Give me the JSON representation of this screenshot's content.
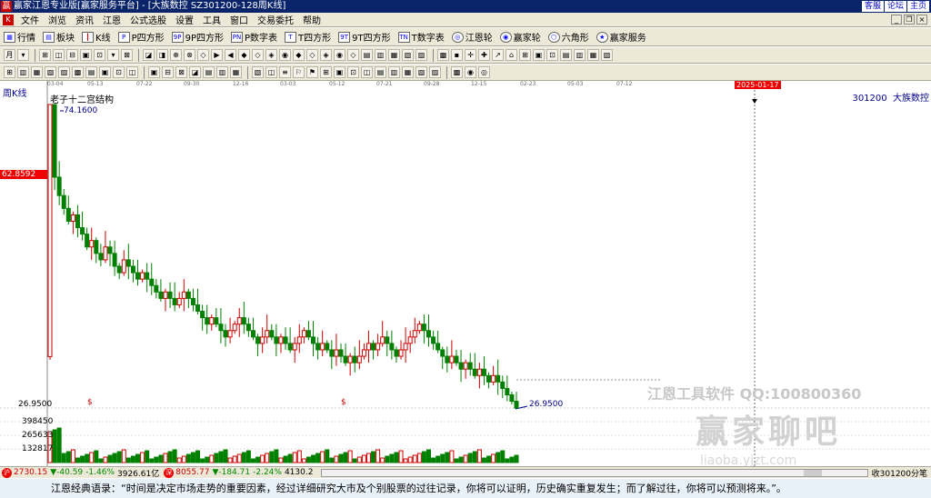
{
  "titlebar": {
    "title": "赢家江恩专业版[赢家服务平台] - [大族数控 SZ301200-128周K线]",
    "links": [
      "客服",
      "论坛",
      "主页"
    ]
  },
  "menubar": {
    "items": [
      "文件",
      "浏览",
      "资讯",
      "江恩",
      "公式选股",
      "设置",
      "工具",
      "窗口",
      "交易委托",
      "帮助"
    ]
  },
  "toolbar1": {
    "items": [
      {
        "label": "行情",
        "icon": "grid-icon"
      },
      {
        "label": "板块",
        "icon": "blocks-icon"
      },
      {
        "label": "K线",
        "icon": "candle-icon"
      },
      {
        "label": "P四方形",
        "icon": "p-square-icon"
      },
      {
        "label": "9P四方形",
        "icon": "9p-square-icon"
      },
      {
        "label": "P数字表",
        "icon": "p-number-table-icon"
      },
      {
        "label": "T四方形",
        "icon": "t-square-icon"
      },
      {
        "label": "9T四方形",
        "icon": "9t-square-icon"
      },
      {
        "label": "T数字表",
        "icon": "t-number-table-icon"
      },
      {
        "label": "江恩轮",
        "icon": "gann-wheel-icon"
      },
      {
        "label": "赢家轮",
        "icon": "winner-wheel-icon"
      },
      {
        "label": "六角形",
        "icon": "hexagon-icon"
      },
      {
        "label": "赢家服务",
        "icon": "service-icon"
      }
    ]
  },
  "chart": {
    "period_label": "周K线",
    "indicator_name": "老子十二宫结构",
    "stock_code": "301200",
    "stock_name": "大族数控",
    "dates": [
      "03-04",
      "05-13",
      "07-22",
      "09-30",
      "12-16",
      "03-03",
      "05-12",
      "07-21",
      "09-28",
      "12-15",
      "02-23",
      "05-03",
      "07-12"
    ],
    "date_marker": "2025-01-17",
    "max_price": "74.1600",
    "min_price": "26.9500",
    "current_price_tag": "62.8592",
    "axis_low": "26.9500",
    "volume_ticks": [
      "398450",
      "265633",
      "132817"
    ],
    "markers": [
      "$",
      "$"
    ]
  },
  "chart_data": {
    "type": "candlestick",
    "title": "老子十二宫结构",
    "max": 74.16,
    "min": 26.95,
    "candles_close_approx": [
      74.16,
      62.86,
      58,
      55,
      52,
      48,
      46,
      47,
      45,
      44,
      46,
      48,
      47,
      45,
      46,
      44,
      42,
      40,
      39,
      38,
      40,
      39,
      38,
      37,
      36,
      37,
      38,
      37,
      36,
      35,
      34,
      33,
      32,
      31,
      30,
      29,
      28,
      26.95
    ]
  },
  "watermark": {
    "line1": "江恩工具软件 QQ:100800360",
    "line2": "赢家聊吧",
    "line3": "liaoba.yjzt.com"
  },
  "statusbar": {
    "index1_value": "2730.15",
    "index1_change": "▼-40.59",
    "index1_pct": "-1.46%",
    "index1_amount": "3926.61亿",
    "index2_value": "8055.77",
    "index2_change": "▼-184.71",
    "index2_pct": "-2.24%",
    "index2_amount": "4130.2",
    "right_info": "收301200分笔"
  },
  "quote": {
    "text": "江恩经典语录：“时间是决定市场走势的重要因素，经过详细研究大市及个别股票的过往记录，你将可以证明，历史确实重复发生；而了解过往，你将可以预测将来。”。"
  }
}
